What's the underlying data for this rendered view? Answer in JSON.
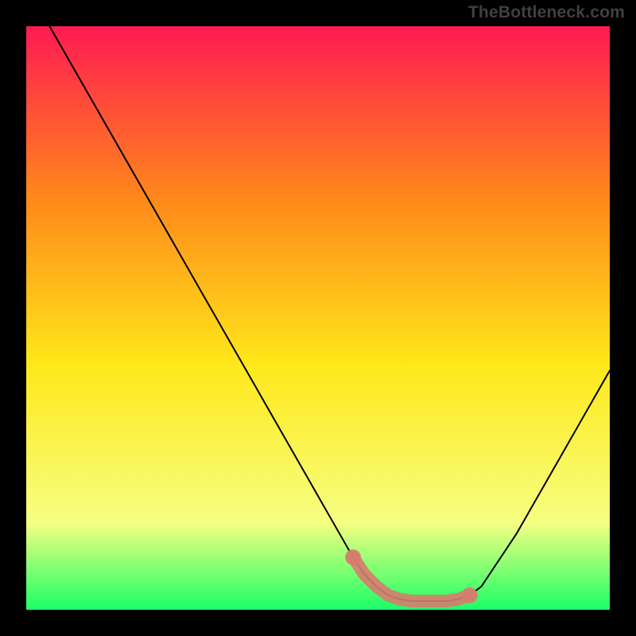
{
  "watermark": "TheBottleneck.com",
  "chart_data": {
    "type": "line",
    "title": "",
    "xlabel": "",
    "ylabel": "",
    "xlim": [
      0,
      100
    ],
    "ylim": [
      0,
      100
    ],
    "background_gradient": {
      "top": "#ff1a52",
      "mid_upper": "#ff8a1a",
      "mid": "#ffe81a",
      "mid_lower": "#f6ff82",
      "bottom": "#1aff66"
    },
    "series": [
      {
        "name": "bottleneck-curve",
        "color": "#000000",
        "x": [
          4,
          8,
          12,
          16,
          20,
          24,
          28,
          32,
          36,
          40,
          44,
          48,
          52,
          56,
          58,
          60,
          62,
          64,
          66,
          68,
          70,
          72,
          74,
          76,
          78,
          80,
          84,
          88,
          92,
          96,
          100
        ],
        "y": [
          100,
          93,
          86,
          79,
          72,
          65,
          58,
          51,
          44,
          37,
          30,
          23,
          16,
          9,
          6,
          4,
          2.5,
          1.8,
          1.5,
          1.5,
          1.5,
          1.5,
          1.8,
          2.5,
          4,
          7,
          13,
          20,
          27,
          34,
          41
        ]
      },
      {
        "name": "bottleneck-minimum-highlight",
        "color": "#d77c6e",
        "x": [
          56,
          58,
          60,
          62,
          64,
          66,
          68,
          70,
          72,
          74,
          76
        ],
        "y": [
          9,
          6,
          4,
          2.5,
          1.8,
          1.5,
          1.5,
          1.5,
          1.5,
          1.8,
          2.5
        ]
      }
    ],
    "markers": [
      {
        "name": "highlight-dot-left",
        "x": 56,
        "y": 9,
        "color": "#d77c6e"
      },
      {
        "name": "highlight-dot-right",
        "x": 76,
        "y": 2.5,
        "color": "#d77c6e"
      }
    ]
  }
}
